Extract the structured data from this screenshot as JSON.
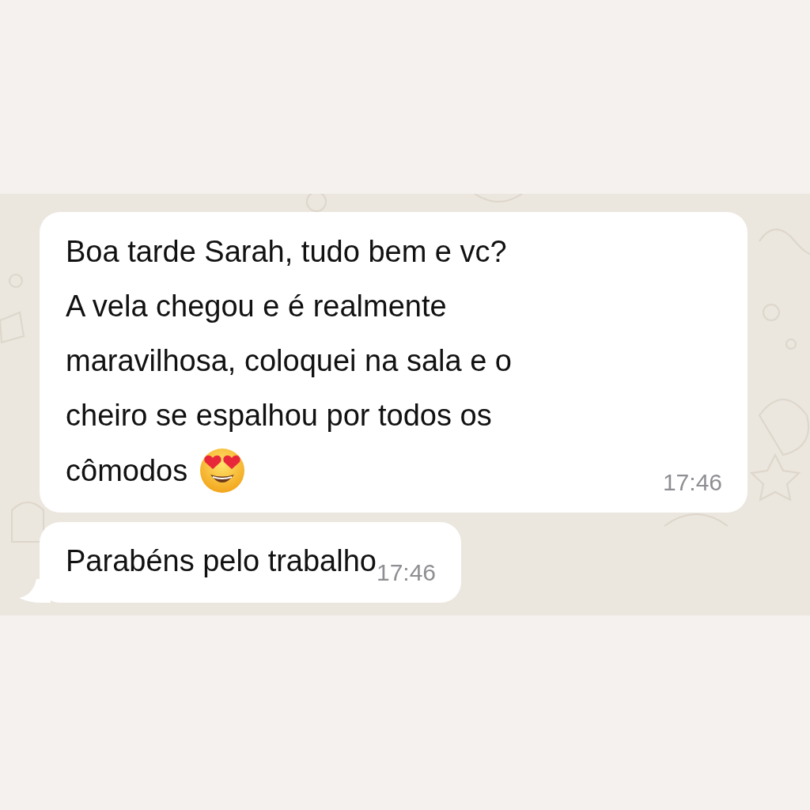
{
  "messages": [
    {
      "lines": [
        "Boa tarde Sarah, tudo bem e vc?",
        "A vela chegou e é realmente",
        "maravilhosa, coloquei na sala e o",
        "cheiro se espalhou por todos os",
        "cômodos"
      ],
      "emoji": true,
      "time": "17:46",
      "tail": false
    },
    {
      "lines": [
        "Parabéns pelo trabalho"
      ],
      "emoji": false,
      "time": "17:46",
      "tail": true
    }
  ]
}
